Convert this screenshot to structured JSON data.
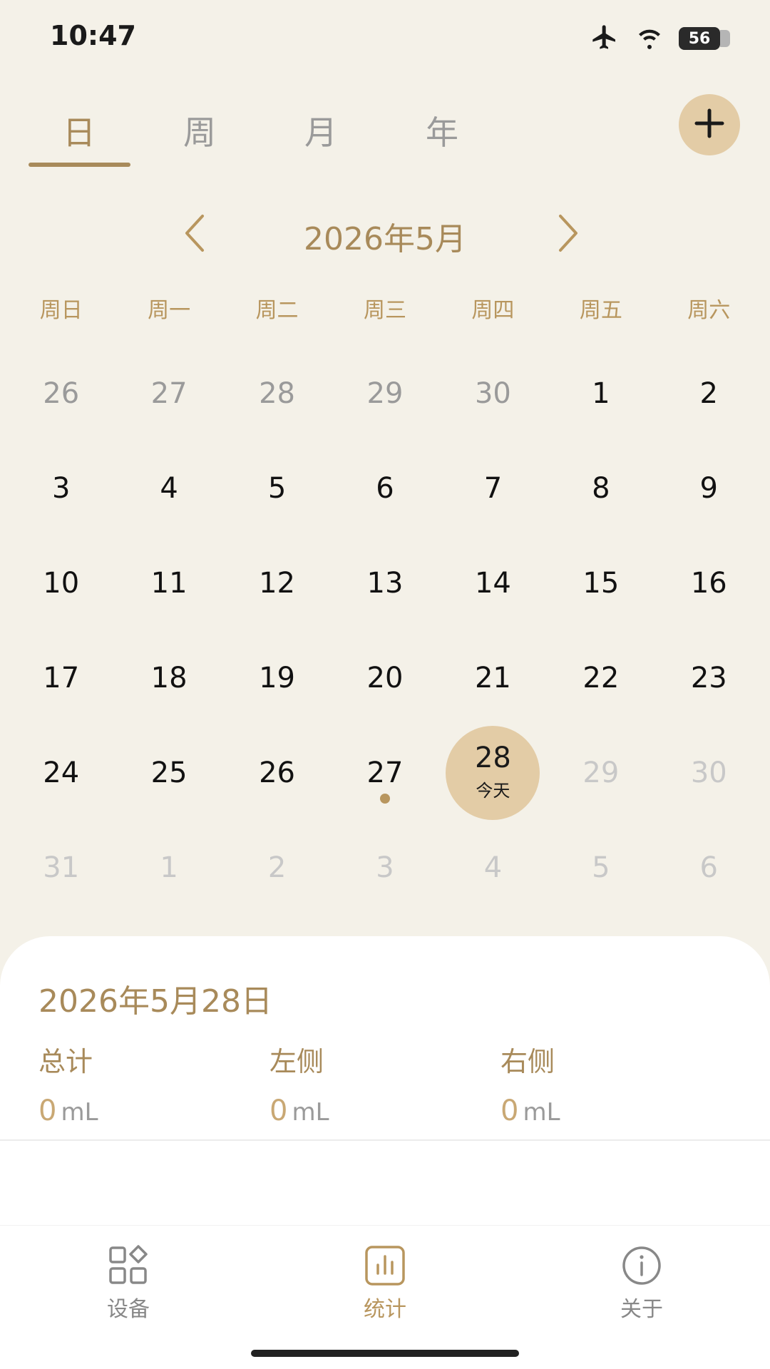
{
  "status_bar": {
    "time": "10:47",
    "battery": "56"
  },
  "tabs": [
    {
      "label": "日",
      "active": true
    },
    {
      "label": "周",
      "active": false
    },
    {
      "label": "月",
      "active": false
    },
    {
      "label": "年",
      "active": false
    }
  ],
  "calendar": {
    "month_title": "2026年5月",
    "weekdays": [
      "周日",
      "周一",
      "周二",
      "周三",
      "周四",
      "周五",
      "周六"
    ],
    "days": [
      {
        "n": "26",
        "state": "outside"
      },
      {
        "n": "27",
        "state": "outside"
      },
      {
        "n": "28",
        "state": "outside"
      },
      {
        "n": "29",
        "state": "outside"
      },
      {
        "n": "30",
        "state": "outside"
      },
      {
        "n": "1",
        "state": "normal"
      },
      {
        "n": "2",
        "state": "normal"
      },
      {
        "n": "3",
        "state": "normal"
      },
      {
        "n": "4",
        "state": "normal"
      },
      {
        "n": "5",
        "state": "normal"
      },
      {
        "n": "6",
        "state": "normal"
      },
      {
        "n": "7",
        "state": "normal"
      },
      {
        "n": "8",
        "state": "normal"
      },
      {
        "n": "9",
        "state": "normal"
      },
      {
        "n": "10",
        "state": "normal"
      },
      {
        "n": "11",
        "state": "normal"
      },
      {
        "n": "12",
        "state": "normal"
      },
      {
        "n": "13",
        "state": "normal"
      },
      {
        "n": "14",
        "state": "normal"
      },
      {
        "n": "15",
        "state": "normal"
      },
      {
        "n": "16",
        "state": "normal"
      },
      {
        "n": "17",
        "state": "normal"
      },
      {
        "n": "18",
        "state": "normal"
      },
      {
        "n": "19",
        "state": "normal"
      },
      {
        "n": "20",
        "state": "normal"
      },
      {
        "n": "21",
        "state": "normal"
      },
      {
        "n": "22",
        "state": "normal"
      },
      {
        "n": "23",
        "state": "normal"
      },
      {
        "n": "24",
        "state": "normal"
      },
      {
        "n": "25",
        "state": "normal"
      },
      {
        "n": "26",
        "state": "normal"
      },
      {
        "n": "27",
        "state": "normal",
        "dot": true
      },
      {
        "n": "28",
        "state": "today",
        "label": "今天"
      },
      {
        "n": "29",
        "state": "future"
      },
      {
        "n": "30",
        "state": "future"
      },
      {
        "n": "31",
        "state": "future"
      },
      {
        "n": "1",
        "state": "future"
      },
      {
        "n": "2",
        "state": "future"
      },
      {
        "n": "3",
        "state": "future"
      },
      {
        "n": "4",
        "state": "future"
      },
      {
        "n": "5",
        "state": "future"
      },
      {
        "n": "6",
        "state": "future"
      }
    ]
  },
  "summary": {
    "date": "2026年5月28日",
    "stats": [
      {
        "label": "总计",
        "value": "0",
        "unit": "mL"
      },
      {
        "label": "左侧",
        "value": "0",
        "unit": "mL"
      },
      {
        "label": "右侧",
        "value": "0",
        "unit": "mL"
      }
    ]
  },
  "bottom_nav": [
    {
      "label": "设备",
      "icon": "devices-icon",
      "active": false
    },
    {
      "label": "统计",
      "icon": "stats-chart-icon",
      "active": true
    },
    {
      "label": "关于",
      "icon": "info-icon",
      "active": false
    }
  ],
  "colors": {
    "accent": "#A88A5A",
    "today_bg": "#E3CCA6",
    "background": "#F4F1E8"
  }
}
